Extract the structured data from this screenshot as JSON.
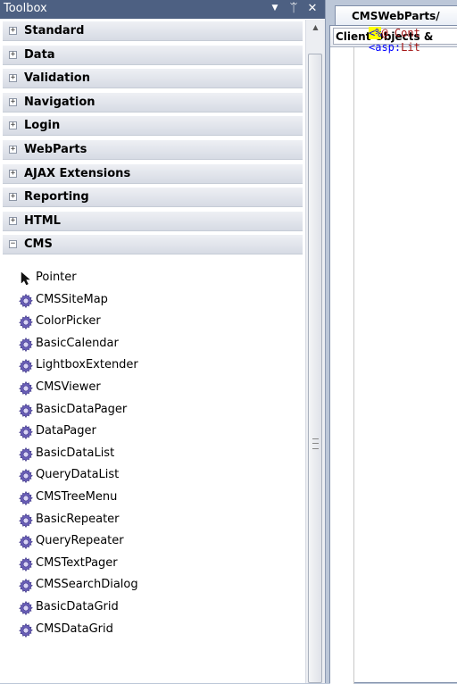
{
  "toolbox": {
    "title": "Toolbox",
    "dropdown_glyph": "▼",
    "pin_glyph": "ᛠ",
    "close_glyph": "✕",
    "scroll_up_glyph": "▲",
    "groups": [
      {
        "label": "Standard",
        "expander": "+"
      },
      {
        "label": "Data",
        "expander": "+"
      },
      {
        "label": "Validation",
        "expander": "+"
      },
      {
        "label": "Navigation",
        "expander": "+"
      },
      {
        "label": "Login",
        "expander": "+"
      },
      {
        "label": "WebParts",
        "expander": "+"
      },
      {
        "label": "AJAX Extensions",
        "expander": "+"
      },
      {
        "label": "Reporting",
        "expander": "+"
      },
      {
        "label": "HTML",
        "expander": "+"
      },
      {
        "label": "CMS",
        "expander": "−"
      }
    ],
    "items": [
      {
        "label": "Pointer",
        "icon": "pointer-icon"
      },
      {
        "label": "CMSSiteMap",
        "icon": "gear-component-icon"
      },
      {
        "label": "ColorPicker",
        "icon": "gear-component-icon"
      },
      {
        "label": "BasicCalendar",
        "icon": "gear-component-icon"
      },
      {
        "label": "LightboxExtender",
        "icon": "gear-component-icon"
      },
      {
        "label": "CMSViewer",
        "icon": "gear-component-icon"
      },
      {
        "label": "BasicDataPager",
        "icon": "gear-component-icon"
      },
      {
        "label": "DataPager",
        "icon": "gear-component-icon"
      },
      {
        "label": "BasicDataList",
        "icon": "gear-component-icon"
      },
      {
        "label": "QueryDataList",
        "icon": "gear-component-icon"
      },
      {
        "label": "CMSTreeMenu",
        "icon": "gear-component-icon"
      },
      {
        "label": "BasicRepeater",
        "icon": "gear-component-icon"
      },
      {
        "label": "QueryRepeater",
        "icon": "gear-component-icon"
      },
      {
        "label": "CMSTextPager",
        "icon": "gear-component-icon"
      },
      {
        "label": "CMSSearchDialog",
        "icon": "gear-component-icon"
      },
      {
        "label": "BasicDataGrid",
        "icon": "gear-component-icon"
      },
      {
        "label": "CMSDataGrid",
        "icon": "gear-component-icon"
      }
    ]
  },
  "editor": {
    "tab_label": "CMSWebParts/",
    "objects_dropdown": "Client Objects &",
    "code_line1_delim": "<%",
    "code_line1_rest": "@ Cont",
    "code_line2_tag": "<asp:",
    "code_line2_rest": "Lit"
  },
  "colors": {
    "header_bg": "#4d6082",
    "icon_purple": "#6a5fb8",
    "directive_highlight": "#ffff00"
  }
}
